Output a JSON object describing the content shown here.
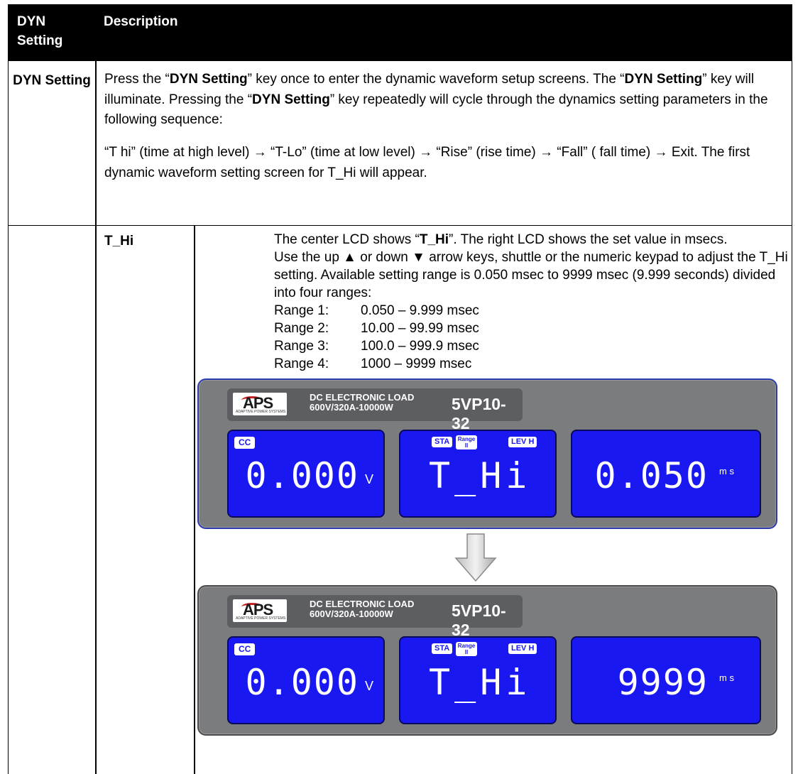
{
  "header": {
    "col1": "DYN Setting",
    "col2": "Description"
  },
  "row1": {
    "label": "DYN Setting",
    "para1": {
      "t1": "Press the “",
      "b1": "DYN Setting",
      "t2": "” key once to enter the dynamic waveform setup screens. The “",
      "b2": "DYN Setting",
      "t3": "” key will illuminate. Pressing the “",
      "b3": "DYN Setting",
      "t4": "” key repeatedly will cycle through the dynamics setting parameters in the following sequence:"
    },
    "para2": "“T hi” (time at high level) → “T-Lo” (time at low level) → “Rise” (rise time) → “Fall” ( fall time) →  Exit. The first dynamic waveform setting screen for T_Hi will appear."
  },
  "row2": {
    "label": "T_Hi",
    "line1": {
      "t1": "The center LCD shows “",
      "b1": "T_Hi",
      "t2": "”. The right LCD shows the set value in msecs."
    },
    "body": "Use the up ▲ or down ▼ arrow keys, shuttle or the numeric keypad  to adjust the T_Hi setting. Available setting range is 0.050 msec to 9999 msec (9.999 seconds) divided into four ranges:",
    "ranges": [
      {
        "label": "Range 1:",
        "value": "0.050 – 9.999 msec"
      },
      {
        "label": "Range 2:",
        "value": "10.00 – 99.99 msec"
      },
      {
        "label": "Range 3:",
        "value": "100.0 – 999.9 msec"
      },
      {
        "label": "Range 4:",
        "value": "1000 – 9999 msec"
      }
    ]
  },
  "panels": [
    {
      "logo": "APS",
      "logo_sub": "ADAPTIVE POWER SYSTEMS",
      "title1": "DC ELECTRONIC LOAD",
      "title2": "600V/320A-10000W",
      "model": "5VP10-32",
      "lcd1": {
        "tag": "CC",
        "value": "0.000",
        "unit": "V"
      },
      "lcd2": {
        "tag_sta": "STA",
        "tag_range": "Range II",
        "tag_lev": "LEV H",
        "value": "T_Hi"
      },
      "lcd3": {
        "value": "0.050",
        "unit": "m s"
      }
    },
    {
      "logo": "APS",
      "logo_sub": "ADAPTIVE POWER SYSTEMS",
      "title1": "DC ELECTRONIC LOAD",
      "title2": "600V/320A-10000W",
      "model": "5VP10-32",
      "lcd1": {
        "tag": "CC",
        "value": "0.000",
        "unit": "V"
      },
      "lcd2": {
        "tag_sta": "STA",
        "tag_range": "Range II",
        "tag_lev": "LEV H",
        "value": "T_Hi"
      },
      "lcd3": {
        "value": "9999",
        "unit": "m s"
      }
    }
  ],
  "colors": {
    "lcd_blue": "#1a18f0",
    "panel_gray": "#7b7c7e",
    "header_black": "#000000"
  }
}
